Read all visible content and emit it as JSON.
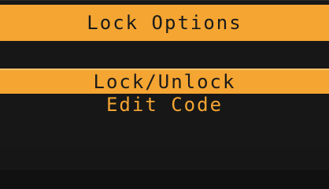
{
  "header": {
    "title": "Lock Options"
  },
  "menu": {
    "items": [
      {
        "label": "Lock/Unlock",
        "selected": true
      },
      {
        "label": "Edit Code",
        "selected": false
      }
    ]
  },
  "colors": {
    "accent": "#f4a532",
    "background": "#171717",
    "text_on_accent": "#1a1a1a"
  }
}
